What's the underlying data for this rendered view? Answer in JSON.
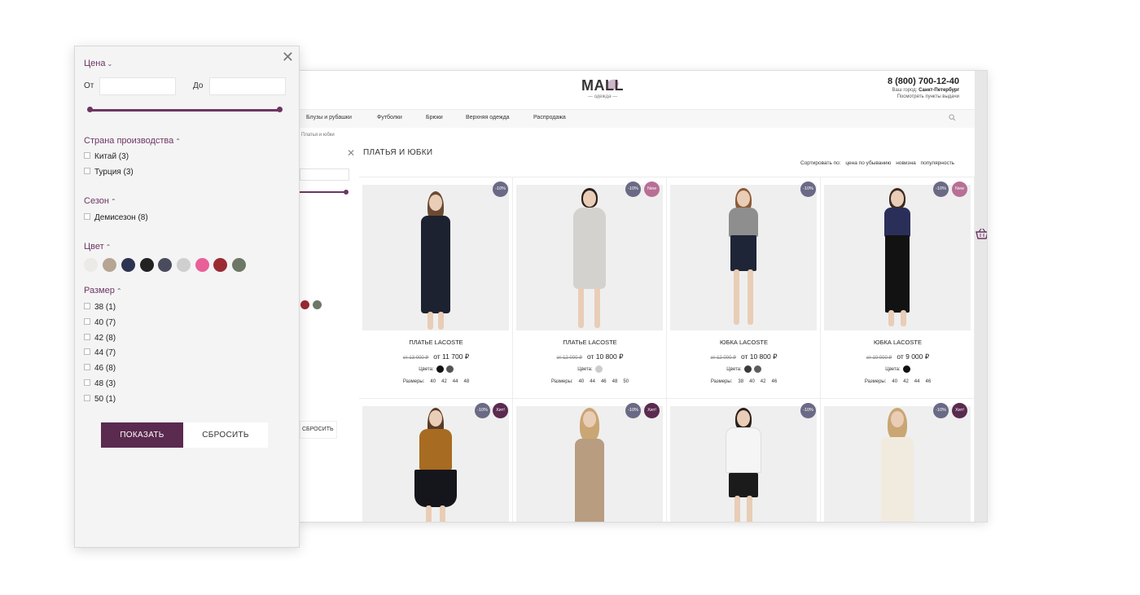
{
  "site": {
    "logo": {
      "main": "MALL",
      "sub": "— одежда —"
    },
    "phone": "8 (800) 700-12-40",
    "city_label": "Ваш город:",
    "city_value": "Санкт-Петербург",
    "pickup": "Посмотреть пункты выдачи",
    "nav": [
      "Блузы и рубашки",
      "Футболки",
      "Брюки",
      "Верхняя одежда",
      "Распродажа"
    ],
    "breadcrumb": "Платья и юбки",
    "category_title": "ПЛАТЬЯ И ЮБКИ",
    "sort": {
      "label": "Сортировать по:",
      "options": [
        "цена по убыванию",
        "новизна",
        "популярность"
      ]
    },
    "under_reset": "СБРОСИТЬ",
    "colors_label": "Цвета:",
    "sizes_label": "Размеры:",
    "products": [
      {
        "name": "ПЛАТЬЕ LACOSTE",
        "old_price": "от 13 000 ₽",
        "price": "от 11 700 ₽",
        "badges": [
          "-10%"
        ],
        "colors": [
          "#111111",
          "#555555"
        ],
        "sizes": [
          "40",
          "42",
          "44",
          "48"
        ]
      },
      {
        "name": "ПЛАТЬЕ LACOSTE",
        "old_price": "от 12 000 ₽",
        "price": "от 10 800 ₽",
        "badges": [
          "-10%",
          "New"
        ],
        "colors": [
          "#cccccc"
        ],
        "sizes": [
          "40",
          "44",
          "46",
          "48",
          "50"
        ]
      },
      {
        "name": "ЮБКА LACOSTE",
        "old_price": "от 12 000 ₽",
        "price": "от 10 800 ₽",
        "badges": [
          "-10%"
        ],
        "colors": [
          "#3a3a3a",
          "#5d5d5d"
        ],
        "sizes": [
          "38",
          "40",
          "42",
          "46"
        ]
      },
      {
        "name": "ЮБКА LACOSTE",
        "old_price": "от 10 000 ₽",
        "price": "от 9 000 ₽",
        "badges": [
          "-10%",
          "New"
        ],
        "colors": [
          "#111111"
        ],
        "sizes": [
          "40",
          "42",
          "44",
          "46"
        ]
      },
      {
        "badges": [
          "-10%",
          "Хит!"
        ]
      },
      {
        "badges": [
          "-10%",
          "Хит!"
        ]
      },
      {
        "badges": [
          "-10%"
        ]
      },
      {
        "badges": [
          "-10%",
          "Хит!"
        ]
      }
    ]
  },
  "filter": {
    "price": {
      "title": "Цена",
      "from_label": "От",
      "to_label": "До",
      "from_value": "",
      "to_value": ""
    },
    "country": {
      "title": "Страна производства",
      "options": [
        "Китай (3)",
        "Турция (3)"
      ]
    },
    "season": {
      "title": "Сезон",
      "options": [
        "Демисезон (8)"
      ]
    },
    "color": {
      "title": "Цвет",
      "swatches": [
        "#eceae6",
        "#b5a592",
        "#2c3452",
        "#222222",
        "#4b4b5e",
        "#cfcfcf",
        "#e8609a",
        "#9b2b33",
        "#6d7766"
      ]
    },
    "size": {
      "title": "Размер",
      "options": [
        "38 (1)",
        "40 (7)",
        "42 (8)",
        "44 (7)",
        "46 (8)",
        "48 (3)",
        "50 (1)"
      ]
    },
    "show_button": "ПОКАЗАТЬ",
    "reset_button": "СБРОСИТЬ"
  },
  "colors": {
    "accent": "#6d3562",
    "button_dark": "#5a2a4f",
    "badge_discount": "#6a6a86",
    "badge_new": "#b86f95",
    "badge_hit": "#5a2a4f"
  },
  "icons": {
    "close": "close-icon",
    "search": "search-icon",
    "cart": "basket-icon",
    "chevron": "chevron-icon"
  }
}
